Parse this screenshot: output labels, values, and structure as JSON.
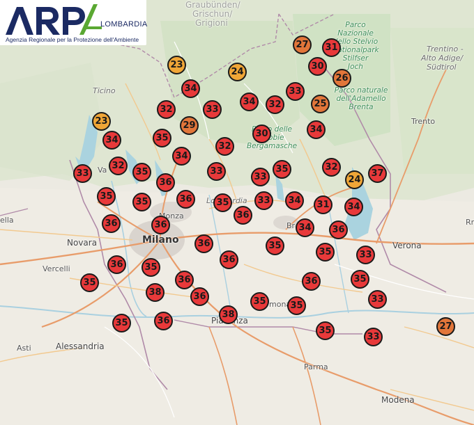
{
  "logo": {
    "wordmark": "ARPA",
    "region": "LOMBARDIA",
    "tagline": "Agenzia Regionale per la Protezione dell'Ambiente",
    "color_navy": "#1b2a63",
    "color_green": "#5aa832"
  },
  "places": {
    "graubunden": "Graubünden/",
    "grischun": "Grischun/",
    "grigioni": "Grigioni",
    "parco_stelvio_1": "Parco Nazionale",
    "parco_stelvio_2": "dello Stelvio",
    "parco_stelvio_3": "Nationalpark",
    "parco_stelvio_4": "Stilfser",
    "parco_stelvio_5": "Joch",
    "trentino_1": "Trentino -",
    "trentino_2": "Alto Adige/",
    "trentino_3": "Südtirol",
    "ticino": "Ticino",
    "parco_adamello_1": "Parco naturale",
    "parco_adamello_2": "dell'Adamello",
    "parco_adamello_3": "Brenta",
    "trento": "Trento",
    "parco_orobie_1": "Parco delle",
    "parco_orobie_2": "Orobie",
    "parco_orobie_3": "Bergamasche",
    "varese": "Va",
    "lombardia": "Lombardia",
    "monza": "Monza",
    "brescia": "Br",
    "ella": "ella",
    "novara": "Novara",
    "milano": "Milano",
    "verona": "Verona",
    "vercelli": "Vercelli",
    "cremona": "mona",
    "asti": "Asti",
    "alessandria": "Alessandria",
    "piacenza": "Piacenza",
    "parma": "Parma",
    "modena": "Modena",
    "rimenti": "Rr"
  },
  "legend_colors": {
    "hot": "#e8393a",
    "warm": "#e2763a",
    "mild": "#f0a637"
  },
  "stations": [
    {
      "value": "27",
      "level": "warm"
    },
    {
      "value": "31",
      "level": "hot"
    },
    {
      "value": "23",
      "level": "mild"
    },
    {
      "value": "24",
      "level": "mild"
    },
    {
      "value": "30",
      "level": "hot"
    },
    {
      "value": "26",
      "level": "warm"
    },
    {
      "value": "34",
      "level": "hot"
    },
    {
      "value": "33",
      "level": "hot"
    },
    {
      "value": "34",
      "level": "hot"
    },
    {
      "value": "32",
      "level": "hot"
    },
    {
      "value": "25",
      "level": "warm"
    },
    {
      "value": "32",
      "level": "hot"
    },
    {
      "value": "33",
      "level": "hot"
    },
    {
      "value": "23",
      "level": "mild"
    },
    {
      "value": "29",
      "level": "warm"
    },
    {
      "value": "30",
      "level": "hot"
    },
    {
      "value": "34",
      "level": "hot"
    },
    {
      "value": "34",
      "level": "hot"
    },
    {
      "value": "35",
      "level": "hot"
    },
    {
      "value": "32",
      "level": "hot"
    },
    {
      "value": "34",
      "level": "hot"
    },
    {
      "value": "32",
      "level": "hot"
    },
    {
      "value": "35",
      "level": "hot"
    },
    {
      "value": "33",
      "level": "hot"
    },
    {
      "value": "33",
      "level": "hot"
    },
    {
      "value": "35",
      "level": "hot"
    },
    {
      "value": "32",
      "level": "hot"
    },
    {
      "value": "24",
      "level": "mild"
    },
    {
      "value": "37",
      "level": "hot"
    },
    {
      "value": "36",
      "level": "hot"
    },
    {
      "value": "35",
      "level": "hot"
    },
    {
      "value": "35",
      "level": "hot"
    },
    {
      "value": "36",
      "level": "hot"
    },
    {
      "value": "35",
      "level": "hot"
    },
    {
      "value": "33",
      "level": "hot"
    },
    {
      "value": "33",
      "level": "hot"
    },
    {
      "value": "34",
      "level": "hot"
    },
    {
      "value": "31",
      "level": "hot"
    },
    {
      "value": "34",
      "level": "hot"
    },
    {
      "value": "36",
      "level": "hot"
    },
    {
      "value": "36",
      "level": "hot"
    },
    {
      "value": "36",
      "level": "hot"
    },
    {
      "value": "34",
      "level": "hot"
    },
    {
      "value": "36",
      "level": "hot"
    },
    {
      "value": "36",
      "level": "hot"
    },
    {
      "value": "35",
      "level": "hot"
    },
    {
      "value": "35",
      "level": "hot"
    },
    {
      "value": "33",
      "level": "hot"
    },
    {
      "value": "36",
      "level": "hot"
    },
    {
      "value": "36",
      "level": "hot"
    },
    {
      "value": "35",
      "level": "hot"
    },
    {
      "value": "35",
      "level": "hot"
    },
    {
      "value": "36",
      "level": "hot"
    },
    {
      "value": "36",
      "level": "hot"
    },
    {
      "value": "35",
      "level": "hot"
    },
    {
      "value": "38",
      "level": "hot"
    },
    {
      "value": "36",
      "level": "hot"
    },
    {
      "value": "33",
      "level": "hot"
    },
    {
      "value": "38",
      "level": "hot"
    },
    {
      "value": "35",
      "level": "hot"
    },
    {
      "value": "35",
      "level": "hot"
    },
    {
      "value": "35",
      "level": "hot"
    },
    {
      "value": "36",
      "level": "hot"
    },
    {
      "value": "35",
      "level": "hot"
    },
    {
      "value": "33",
      "level": "hot"
    },
    {
      "value": "27",
      "level": "warm"
    }
  ]
}
